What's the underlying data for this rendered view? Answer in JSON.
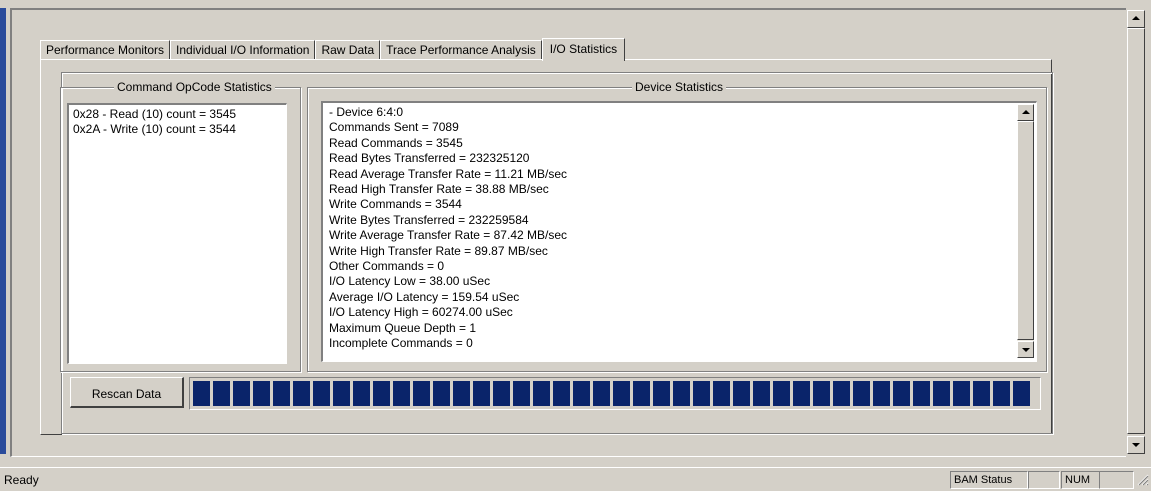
{
  "tabs": [
    {
      "label": "Performance Monitors"
    },
    {
      "label": "Individual I/O Information"
    },
    {
      "label": "Raw Data"
    },
    {
      "label": "Trace Performance Analysis"
    },
    {
      "label": "I/O Statistics",
      "active": true
    }
  ],
  "opcode_group": {
    "title": "Command OpCode Statistics",
    "lines": [
      "0x28 - Read (10) count = 3545",
      "0x2A - Write (10) count = 3544"
    ]
  },
  "device_group": {
    "title": "Device Statistics",
    "lines": [
      "- Device 6:4:0",
      "Commands Sent = 7089",
      "Read Commands = 3545",
      "Read Bytes Transferred = 232325120",
      "Read Average Transfer Rate = 11.21 MB/sec",
      "Read High Transfer Rate = 38.88 MB/sec",
      "Write Commands = 3544",
      "Write Bytes Transferred = 232259584",
      "Write Average Transfer Rate = 87.42 MB/sec",
      "Write High Transfer Rate = 89.87 MB/sec",
      "Other Commands = 0",
      "I/O Latency Low = 38.00 uSec",
      "Average I/O Latency = 159.54 uSec",
      "I/O Latency High = 60274.00 uSec",
      "Maximum Queue Depth = 1",
      "Incomplete Commands = 0"
    ]
  },
  "rescan": {
    "label": "Rescan Data"
  },
  "progress": {
    "fraction": 1.0,
    "color": "#0a246a"
  },
  "statusbar": {
    "text": "Ready",
    "panes": [
      "BAM Status",
      "",
      "NUM",
      ""
    ]
  },
  "icons": {
    "scroll_up": "arrow-up-icon",
    "scroll_down": "arrow-down-icon",
    "grip": "resize-grip-icon"
  }
}
